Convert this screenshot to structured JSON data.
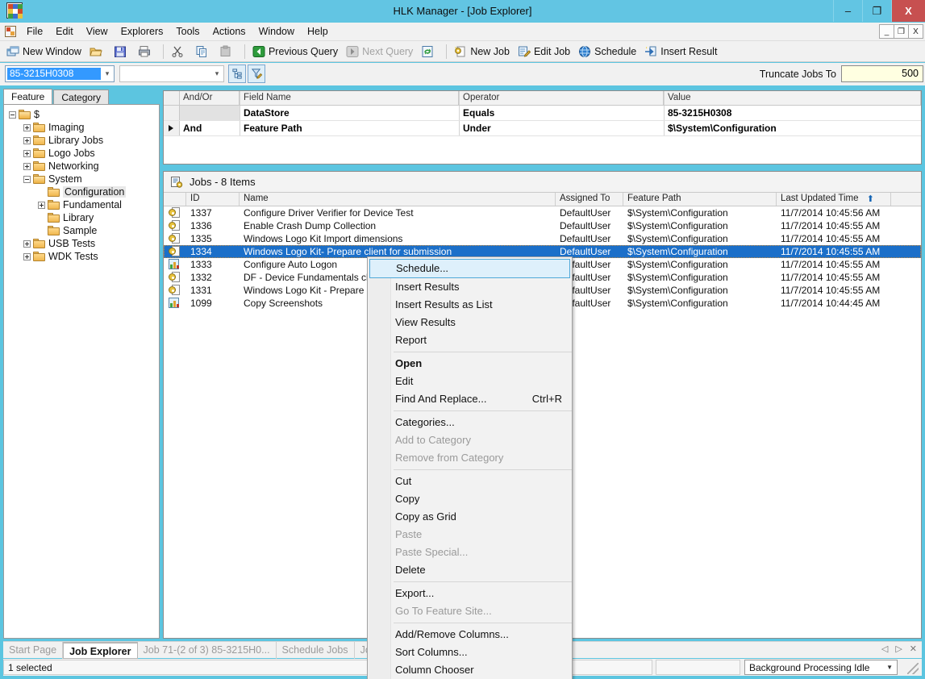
{
  "window": {
    "title": "HLK Manager - [Job Explorer]",
    "controls": {
      "minimize": "–",
      "maximize": "❐",
      "close": "X"
    },
    "mdi_controls": {
      "minimize": "_",
      "restore": "❐",
      "close": "X"
    }
  },
  "menubar": {
    "items": [
      "File",
      "Edit",
      "View",
      "Explorers",
      "Tools",
      "Actions",
      "Window",
      "Help"
    ]
  },
  "toolbar": {
    "new_window": "New Window",
    "open": "",
    "save": "",
    "print": "",
    "cut": "",
    "copy": "",
    "paste": "",
    "previous_query": "Previous Query",
    "next_query": "Next Query",
    "refresh": "",
    "new_job": "New Job",
    "edit_job": "Edit Job",
    "schedule": "Schedule",
    "insert_result": "Insert Result"
  },
  "querybar": {
    "datastore_value": "85-3215H0308",
    "second_combo_value": "",
    "truncate_label": "Truncate Jobs To",
    "truncate_value": "500"
  },
  "left_panel": {
    "tabs": [
      {
        "label": "Feature",
        "active": true
      },
      {
        "label": "Category",
        "active": false
      }
    ],
    "tree": [
      {
        "label": "$",
        "depth": 0,
        "expander": "minus",
        "open": true
      },
      {
        "label": "Imaging",
        "depth": 1,
        "expander": "plus",
        "open": false
      },
      {
        "label": "Library Jobs",
        "depth": 1,
        "expander": "plus",
        "open": false
      },
      {
        "label": "Logo Jobs",
        "depth": 1,
        "expander": "plus",
        "open": false
      },
      {
        "label": "Networking",
        "depth": 1,
        "expander": "plus",
        "open": false
      },
      {
        "label": "System",
        "depth": 1,
        "expander": "minus",
        "open": true
      },
      {
        "label": "Configuration",
        "depth": 2,
        "expander": "none",
        "open": false,
        "selected": true
      },
      {
        "label": "Fundamental",
        "depth": 2,
        "expander": "plus",
        "open": false
      },
      {
        "label": "Library",
        "depth": 2,
        "expander": "none",
        "open": false
      },
      {
        "label": "Sample",
        "depth": 2,
        "expander": "none",
        "open": false
      },
      {
        "label": "USB Tests",
        "depth": 1,
        "expander": "plus",
        "open": false
      },
      {
        "label": "WDK Tests",
        "depth": 1,
        "expander": "plus",
        "open": false
      }
    ]
  },
  "query_grid": {
    "headers": [
      "And/Or",
      "Field Name",
      "Operator",
      "Value"
    ],
    "rows": [
      {
        "andor": "",
        "field": "DataStore",
        "operator": "Equals",
        "value": "85-3215H0308",
        "current": false
      },
      {
        "andor": "And",
        "field": "Feature Path",
        "operator": "Under",
        "value": "$\\System\\Configuration",
        "current": true
      }
    ]
  },
  "jobs_panel": {
    "caption": "Jobs - 8 Items",
    "headers": [
      "ID",
      "Name",
      "Assigned To",
      "Feature Path",
      "Last Updated Time"
    ],
    "rows": [
      {
        "icon": "job-gear-icon",
        "id": "1337",
        "name": "Configure Driver Verifier for Device Test",
        "assigned": "DefaultUser",
        "feature": "$\\System\\Configuration",
        "updated": "11/7/2014 10:45:56 AM",
        "selected": false
      },
      {
        "icon": "job-gear-icon",
        "id": "1336",
        "name": "Enable Crash Dump Collection",
        "assigned": "DefaultUser",
        "feature": "$\\System\\Configuration",
        "updated": "11/7/2014 10:45:55 AM",
        "selected": false
      },
      {
        "icon": "job-gear-icon",
        "id": "1335",
        "name": "Windows Logo Kit Import dimensions",
        "assigned": "DefaultUser",
        "feature": "$\\System\\Configuration",
        "updated": "11/7/2014 10:45:55 AM",
        "selected": false
      },
      {
        "icon": "job-gear-icon",
        "id": "1334",
        "name": "Windows Logo Kit- Prepare client for submission",
        "assigned": "DefaultUser",
        "feature": "$\\System\\Configuration",
        "updated": "11/7/2014 10:45:55 AM",
        "selected": true
      },
      {
        "icon": "job-chart-icon",
        "id": "1333",
        "name": "Configure Auto Logon",
        "assigned": "DefaultUser",
        "feature": "$\\System\\Configuration",
        "updated": "11/7/2014 10:45:55 AM",
        "selected": false
      },
      {
        "icon": "job-gear-icon",
        "id": "1332",
        "name": "DF - Device Fundamentals cleanup",
        "assigned": "DefaultUser",
        "feature": "$\\System\\Configuration",
        "updated": "11/7/2014 10:45:55 AM",
        "selected": false
      },
      {
        "icon": "job-gear-icon",
        "id": "1331",
        "name": "Windows Logo Kit - Prepare client",
        "assigned": "DefaultUser",
        "feature": "$\\System\\Configuration",
        "updated": "11/7/2014 10:45:55 AM",
        "selected": false
      },
      {
        "icon": "job-chart-icon",
        "id": "1099",
        "name": "Copy Screenshots",
        "assigned": "DefaultUser",
        "feature": "$\\System\\Configuration",
        "updated": "11/7/2014 10:44:45 AM",
        "selected": false
      }
    ]
  },
  "context_menu": {
    "items": [
      {
        "label": "Schedule...",
        "highlighted": true
      },
      {
        "label": "Insert Results"
      },
      {
        "label": "Insert Results as List"
      },
      {
        "label": "View Results"
      },
      {
        "label": "Report"
      },
      {
        "separator": true
      },
      {
        "label": "Open",
        "bold": true
      },
      {
        "label": "Edit"
      },
      {
        "label": "Find And Replace...",
        "shortcut": "Ctrl+R"
      },
      {
        "separator": true
      },
      {
        "label": "Categories..."
      },
      {
        "label": "Add to Category",
        "disabled": true
      },
      {
        "label": "Remove from Category",
        "disabled": true
      },
      {
        "separator": true
      },
      {
        "label": "Cut"
      },
      {
        "label": "Copy"
      },
      {
        "label": "Copy as Grid"
      },
      {
        "label": "Paste",
        "disabled": true
      },
      {
        "label": "Paste Special...",
        "disabled": true
      },
      {
        "label": "Delete"
      },
      {
        "separator": true
      },
      {
        "label": "Export..."
      },
      {
        "label": "Go To Feature Site...",
        "disabled": true
      },
      {
        "separator": true
      },
      {
        "label": "Add/Remove Columns..."
      },
      {
        "label": "Sort Columns..."
      },
      {
        "label": "Column Chooser"
      }
    ]
  },
  "bottom_tabs": {
    "items": [
      {
        "label": "Start Page",
        "active": false
      },
      {
        "label": "Job Explorer",
        "active": true
      },
      {
        "label": "Job 71-(2 of 3) 85-3215H0...",
        "active": false
      },
      {
        "label": "Schedule Jobs",
        "active": false
      },
      {
        "label": "Job Monitor",
        "active": false
      }
    ],
    "nav": {
      "prev": "◁",
      "next": "▷",
      "close": "✕"
    }
  },
  "statusbar": {
    "left_text": "1 selected",
    "mid_text": "",
    "background_state": "Background Processing Idle"
  },
  "colors": {
    "window_chrome": "#62c5e3",
    "selection_blue": "#1b6fc9",
    "close_red": "#c75050",
    "menu_highlight": "#def0fb",
    "truncate_field": "#ffffe1"
  }
}
